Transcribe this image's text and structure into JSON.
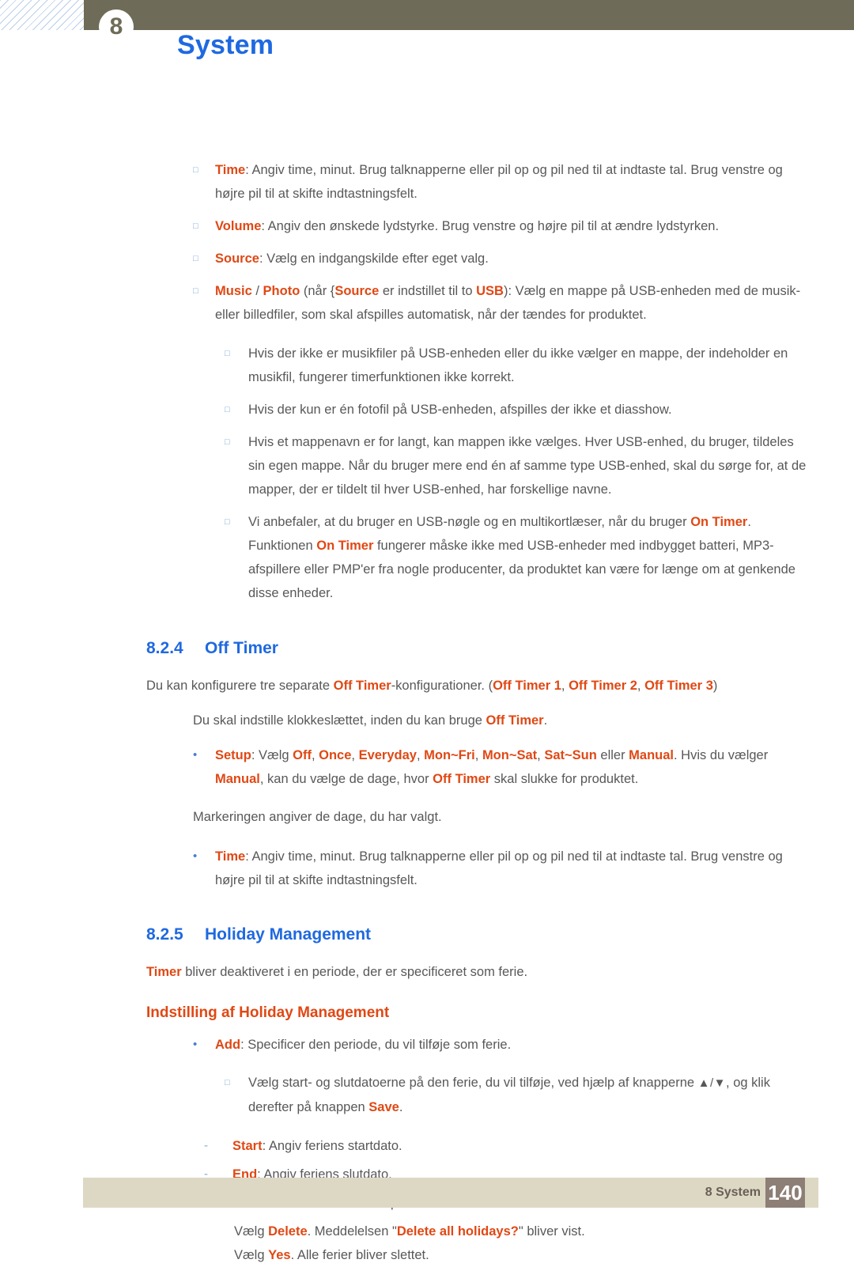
{
  "header": {
    "chapter_number": "8",
    "title": "System",
    "title_color": "#1f69e0",
    "bar_color": "#6e6c58"
  },
  "footer": {
    "chapter_label": "8 System",
    "page_number": "140",
    "bar_color": "#ddd8c4",
    "page_box_color": "#8d7f75"
  },
  "accent_color": "#e04814",
  "link_color": "#1f69e0",
  "intro_bullets": [
    {
      "marker": "□",
      "segments": [
        {
          "t": "Time",
          "s": "kw"
        },
        {
          "t": ": Angiv time, minut. Brug talknapperne eller pil op og pil ned til at indtaste tal. Brug venstre og højre pil til at skifte indtastningsfelt.",
          "s": ""
        }
      ]
    },
    {
      "marker": "□",
      "segments": [
        {
          "t": "Volume",
          "s": "kw"
        },
        {
          "t": ": Angiv den ønskede lydstyrke. Brug venstre og højre pil til at ændre lydstyrken.",
          "s": ""
        }
      ]
    },
    {
      "marker": "□",
      "segments": [
        {
          "t": "Source",
          "s": "kw"
        },
        {
          "t": ": Vælg en indgangskilde efter eget valg.",
          "s": ""
        }
      ]
    },
    {
      "marker": "□",
      "segments": [
        {
          "t": "Music",
          "s": "kw"
        },
        {
          "t": " / ",
          "s": ""
        },
        {
          "t": "Photo",
          "s": "kw"
        },
        {
          "t": " (når {",
          "s": ""
        },
        {
          "t": "Source",
          "s": "kw"
        },
        {
          "t": " er indstillet til to ",
          "s": ""
        },
        {
          "t": "USB",
          "s": "kw"
        },
        {
          "t": "): Vælg en mappe på USB-enheden med de musik- eller billedfiler, som skal afspilles automatisk, når der tændes for produktet.",
          "s": ""
        }
      ]
    }
  ],
  "nested_notes": [
    {
      "marker": "□",
      "segments": [
        {
          "t": "Hvis der ikke er musikfiler på USB-enheden eller du ikke vælger en mappe, der indeholder en musikfil, fungerer timerfunktionen ikke korrekt.",
          "s": ""
        }
      ]
    },
    {
      "marker": "□",
      "segments": [
        {
          "t": "Hvis der kun er én fotofil på USB-enheden, afspilles der ikke et diasshow.",
          "s": ""
        }
      ]
    },
    {
      "marker": "□",
      "segments": [
        {
          "t": "Hvis et mappenavn er for langt, kan mappen ikke vælges. Hver USB-enhed, du bruger, tildeles sin egen mappe. Når du bruger mere end én af samme type USB-enhed, skal du sørge for, at de mapper, der er tildelt til hver USB-enhed, har forskellige navne.",
          "s": ""
        }
      ]
    },
    {
      "marker": "□",
      "segments": [
        {
          "t": "Vi anbefaler, at du bruger en USB-nøgle og en multikortlæser, når du bruger ",
          "s": ""
        },
        {
          "t": "On Timer",
          "s": "kw"
        },
        {
          "t": ". Funktionen ",
          "s": ""
        },
        {
          "t": "On Timer",
          "s": "kw"
        },
        {
          "t": " fungerer måske ikke med USB-enheder med indbygget batteri, MP3-afspillere eller PMP'er fra nogle producenter, da produktet kan være for længe om at genkende disse enheder.",
          "s": ""
        }
      ]
    }
  ],
  "section_824": {
    "number": "8.2.4",
    "title": "Off Timer",
    "intro": [
      {
        "t": "Du kan konfigurere tre separate ",
        "s": ""
      },
      {
        "t": "Off Timer",
        "s": "kw"
      },
      {
        "t": "-konfigurationer. (",
        "s": ""
      },
      {
        "t": "Off Timer 1",
        "s": "kw"
      },
      {
        "t": ", ",
        "s": ""
      },
      {
        "t": "Off Timer 2",
        "s": "kw"
      },
      {
        "t": ", ",
        "s": ""
      },
      {
        "t": "Off Timer 3",
        "s": "kw"
      },
      {
        "t": ")",
        "s": ""
      }
    ],
    "note": [
      {
        "t": "Du skal indstille klokkeslættet, inden du kan bruge ",
        "s": ""
      },
      {
        "t": "Off Timer",
        "s": "kw"
      },
      {
        "t": ".",
        "s": ""
      }
    ],
    "bullets": [
      {
        "marker": "•",
        "segments": [
          {
            "t": "Setup",
            "s": "kw"
          },
          {
            "t": ": Vælg ",
            "s": ""
          },
          {
            "t": "Off",
            "s": "kw"
          },
          {
            "t": ", ",
            "s": ""
          },
          {
            "t": "Once",
            "s": "kw"
          },
          {
            "t": ", ",
            "s": ""
          },
          {
            "t": "Everyday",
            "s": "kw"
          },
          {
            "t": ", ",
            "s": ""
          },
          {
            "t": "Mon~Fri",
            "s": "kw"
          },
          {
            "t": ", ",
            "s": ""
          },
          {
            "t": "Mon~Sat",
            "s": "kw"
          },
          {
            "t": ", ",
            "s": ""
          },
          {
            "t": "Sat~Sun",
            "s": "kw"
          },
          {
            "t": " eller ",
            "s": ""
          },
          {
            "t": "Manual",
            "s": "kw"
          },
          {
            "t": ". Hvis du vælger ",
            "s": ""
          },
          {
            "t": "Manual",
            "s": "kw"
          },
          {
            "t": ", kan du vælge de dage, hvor ",
            "s": ""
          },
          {
            "t": "Off Timer",
            "s": "kw"
          },
          {
            "t": " skal slukke for produktet.",
            "s": ""
          }
        ]
      }
    ],
    "marking_note": "Markeringen angiver de dage, du har valgt.",
    "time_bullet": {
      "marker": "•",
      "segments": [
        {
          "t": "Time",
          "s": "kw"
        },
        {
          "t": ": Angiv time, minut. Brug talknapperne eller pil op og pil ned til at indtaste tal. Brug venstre og højre pil til at skifte indtastningsfelt.",
          "s": ""
        }
      ]
    }
  },
  "section_825": {
    "number": "8.2.5",
    "title": "Holiday Management",
    "intro": [
      {
        "t": "Timer",
        "s": "kw"
      },
      {
        "t": " bliver deaktiveret i en periode, der er specificeret som ferie.",
        "s": ""
      }
    ],
    "subheading": "Indstilling af Holiday Management",
    "add_bullet": {
      "marker": "•",
      "segments": [
        {
          "t": "Add",
          "s": "kw"
        },
        {
          "t": ": Specificer den periode, du vil tilføje som ferie.",
          "s": ""
        }
      ]
    },
    "choose_dates": {
      "marker": "□",
      "segments": [
        {
          "t": "Vælg start- og slutdatoerne på den ferie, du vil tilføje, ved hjælp af knapperne ",
          "s": ""
        },
        {
          "t": "▲/▼",
          "s": "tri"
        },
        {
          "t": ", og klik derefter på knappen ",
          "s": ""
        },
        {
          "t": "Save",
          "s": "kw"
        },
        {
          "t": ".",
          "s": ""
        }
      ]
    },
    "dash_items": [
      {
        "marker": "-",
        "segments": [
          {
            "t": "Start",
            "s": "kw"
          },
          {
            "t": ": Angiv feriens startdato.",
            "s": ""
          }
        ]
      },
      {
        "marker": "-",
        "segments": [
          {
            "t": "End",
            "s": "kw"
          },
          {
            "t": ": Angiv feriens slutdato.",
            "s": ""
          }
        ]
      },
      {
        "marker": "-",
        "segments": [
          {
            "t": "Delete",
            "s": "kw"
          },
          {
            "t": ": Slet alle elementer på listen med ferier.",
            "s": ""
          }
        ]
      }
    ],
    "delete_steps": [
      [
        {
          "t": "Vælg ",
          "s": ""
        },
        {
          "t": "Delete",
          "s": "kw"
        },
        {
          "t": ". Meddelelsen \"",
          "s": ""
        },
        {
          "t": "Delete all holidays?",
          "s": "kw"
        },
        {
          "t": "\" bliver vist.",
          "s": ""
        }
      ],
      [
        {
          "t": "Vælg ",
          "s": ""
        },
        {
          "t": "Yes",
          "s": "kw"
        },
        {
          "t": ". Alle ferier bliver slettet.",
          "s": ""
        }
      ]
    ]
  }
}
